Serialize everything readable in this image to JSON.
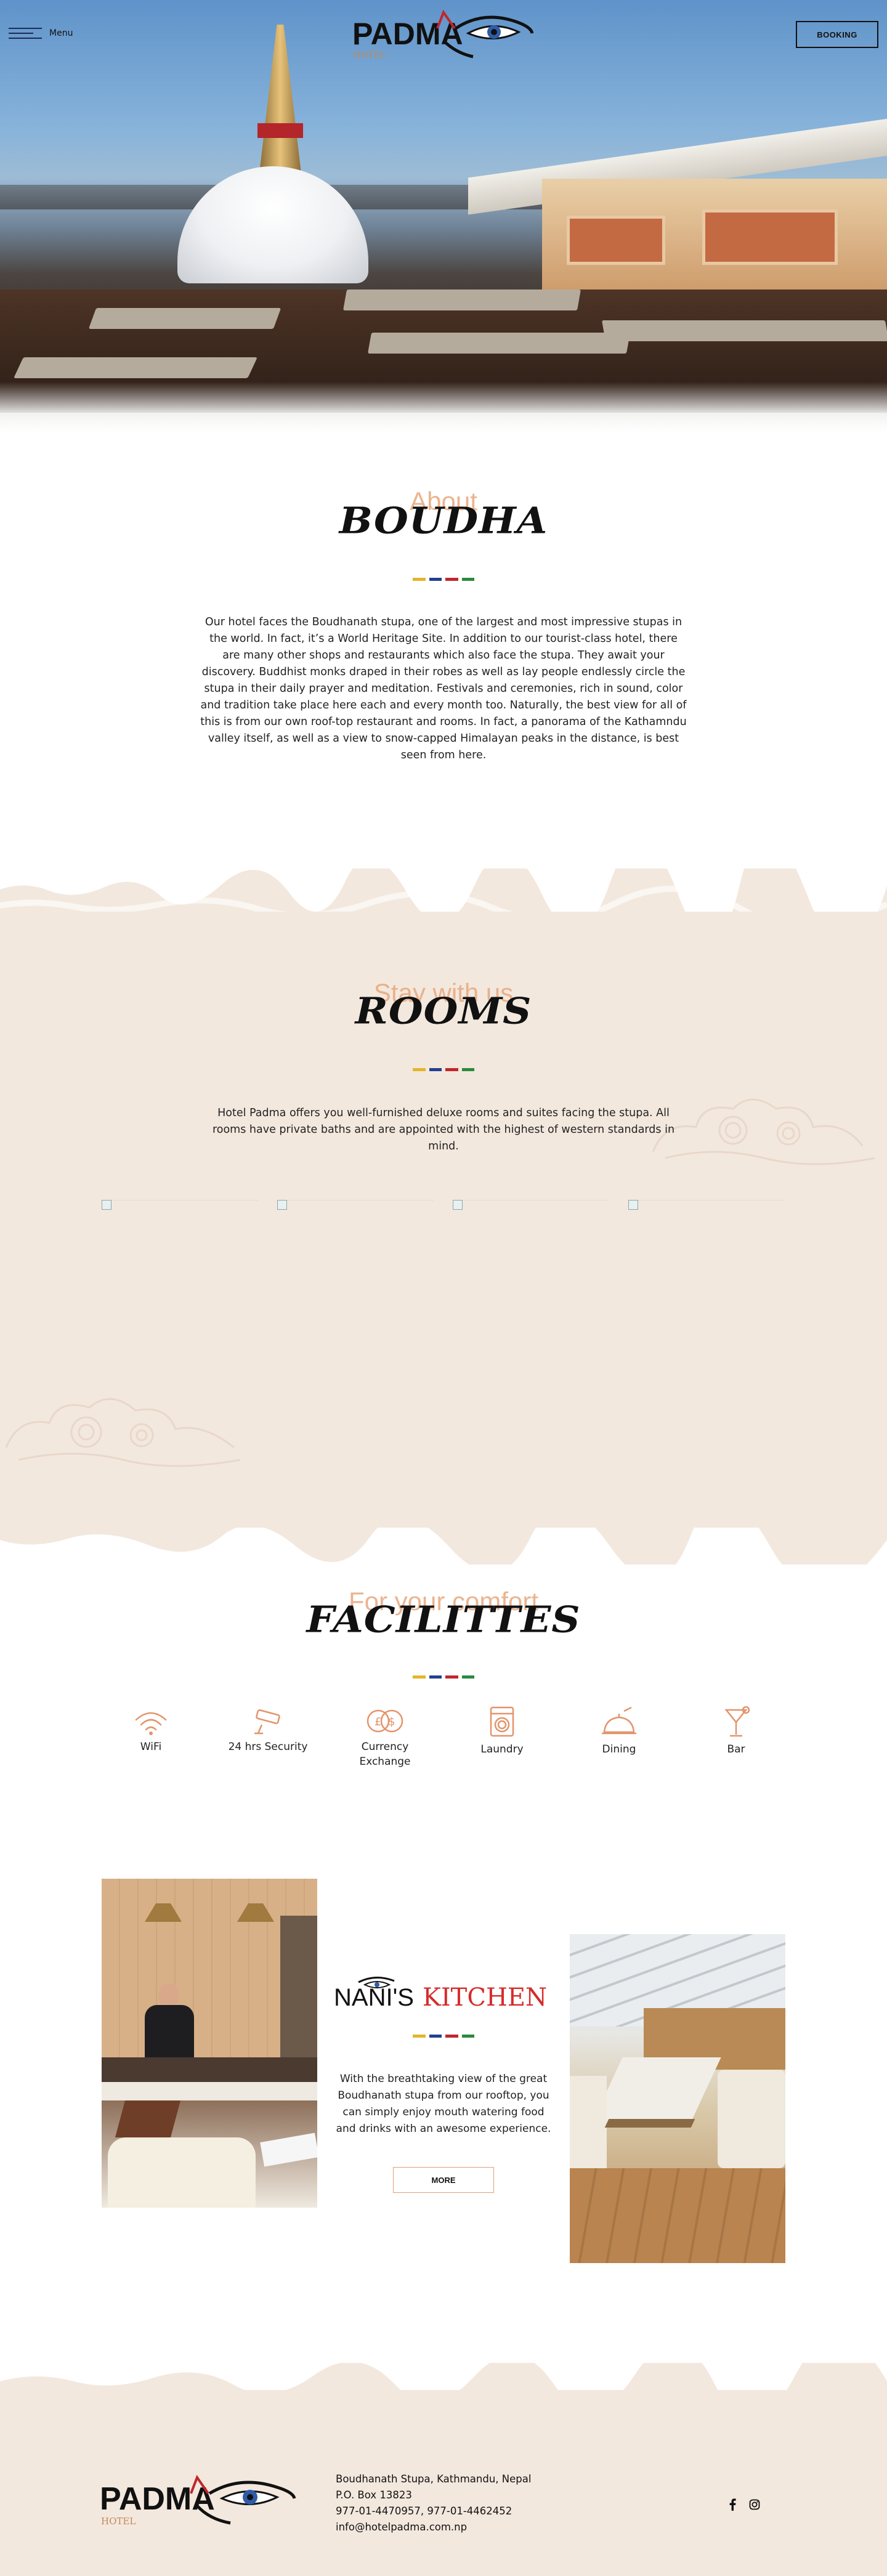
{
  "header": {
    "menu_label": "Menu",
    "booking_label": "BOOKING",
    "logo_text": "PADMA",
    "logo_sub": "HOTEL"
  },
  "about": {
    "eyebrow": "About",
    "title": "BOUDHA",
    "body": "Our hotel faces the Boudhanath stupa, one of the largest and most impressive stupas in the world. In fact, it’s a World Heritage Site. In addition to our tourist-class hotel, there are many other shops and restaurants which also face the stupa. They await your discovery. Buddhist monks draped in their robes as well as lay people endlessly circle the stupa in their daily prayer and meditation. Festivals and ceremonies, rich in sound, color and tradition take place here each and every month too. Naturally, the best view for all of this is from our own roof-top restaurant and rooms. In fact, a panorama of the Kathamndu valley itself, as well as a view to snow-capped Himalayan peaks in the distance, is best seen from here."
  },
  "rooms": {
    "eyebrow": "Stay with us",
    "title": "ROOMS",
    "body": "Hotel Padma offers you well-furnished deluxe rooms and suites facing the stupa. All rooms have private baths and are appointed with the highest of western standards in mind."
  },
  "facilities": {
    "eyebrow": "For your comfort",
    "title": "FACILITTES",
    "items": [
      {
        "label": "WiFi",
        "icon": "wifi-icon"
      },
      {
        "label": "24 hrs Security",
        "icon": "cctv-icon"
      },
      {
        "label": "Currency\nExchange",
        "icon": "currency-exchange-icon"
      },
      {
        "label": "Laundry",
        "icon": "washing-machine-icon"
      },
      {
        "label": "Dining",
        "icon": "dining-icon"
      },
      {
        "label": "Bar",
        "icon": "cocktail-icon"
      }
    ]
  },
  "kitchen": {
    "logo_a": "NANI'S",
    "logo_b": "KITCHEN",
    "body": "With the breathtaking view of the great Boudhanath stupa from our rooftop, you can simply enjoy mouth watering food and drinks with an awesome experience.",
    "more_label": "MORE"
  },
  "footer": {
    "address": "Boudhanath Stupa, Kathmandu, Nepal",
    "po_box": "P.O. Box 13823",
    "phones": "977-01-4470957, 977-01-4462452",
    "email": "info@hotelpadma.com.np",
    "social": [
      "facebook-icon",
      "instagram-icon"
    ]
  },
  "colors": {
    "accent": "#e8a87c",
    "paper": "#f3e8de",
    "divider": [
      "#e3b52b",
      "#24408e",
      "#c0272d",
      "#2a8a3e"
    ],
    "logo_red": "#c0272d",
    "kitchen_red": "#d52b2b"
  }
}
